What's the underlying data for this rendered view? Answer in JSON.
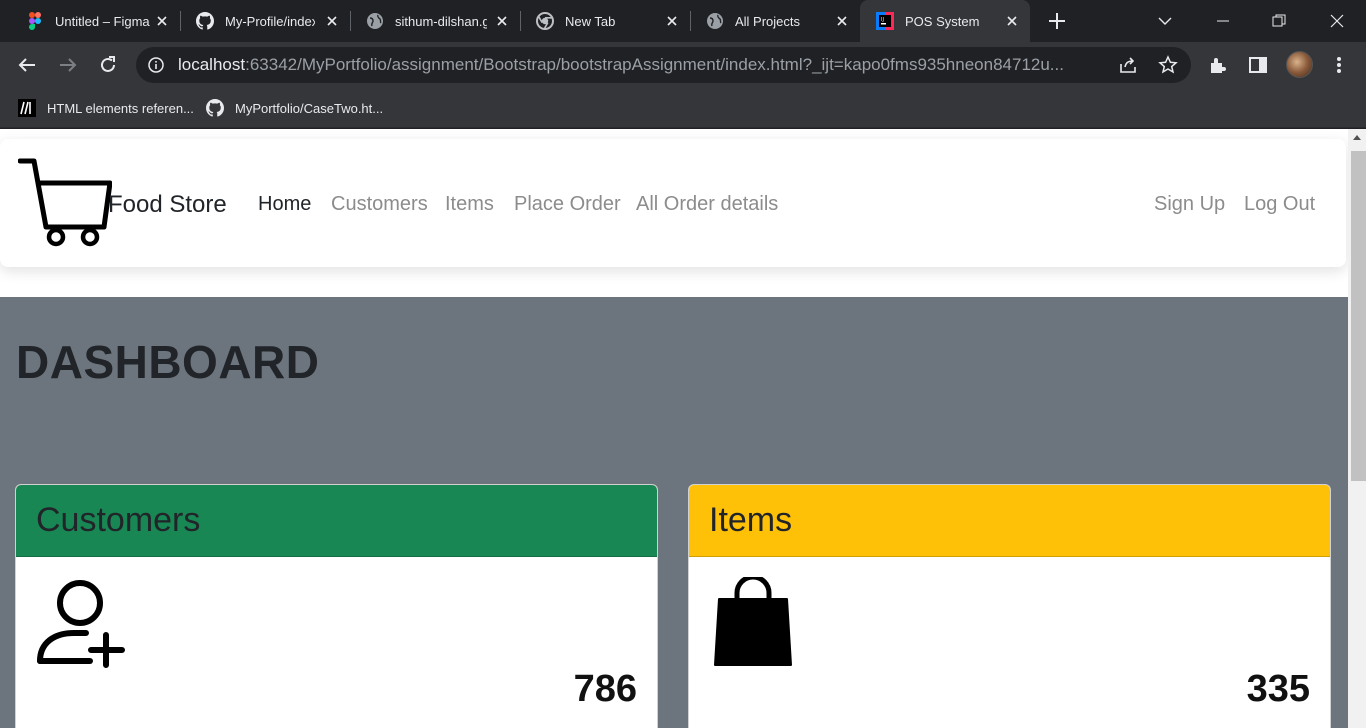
{
  "browser": {
    "tabs": [
      {
        "title": "Untitled – Figma",
        "icon": "figma-icon"
      },
      {
        "title": "My-Profile/index",
        "icon": "github-icon"
      },
      {
        "title": "sithum-dilshan.g",
        "icon": "globe-icon"
      },
      {
        "title": "New Tab",
        "icon": "chrome-icon"
      },
      {
        "title": "All Projects",
        "icon": "globe-icon"
      },
      {
        "title": "POS System",
        "icon": "jetbrains-icon",
        "active": true
      }
    ],
    "url_host": "localhost",
    "url_rest": ":63342/MyPortfolio/assignment/Bootstrap/bootstrapAssignment/index.html?_ijt=kapo0fms935hneon84712u...",
    "bookmarks": [
      {
        "label": "HTML elements referen...",
        "icon": "mdn-icon"
      },
      {
        "label": "MyPortfolio/CaseTwo.ht...",
        "icon": "github-icon"
      }
    ]
  },
  "navbar": {
    "brand": "Food Store",
    "links": [
      "Home",
      "Customers",
      "Items",
      "Place Order",
      "All Order details"
    ],
    "right_links": [
      "Sign Up",
      "Log Out"
    ]
  },
  "dashboard": {
    "title": "DASHBOARD",
    "cards": [
      {
        "title": "Customers",
        "count": "786",
        "header_color": "#198754",
        "icon": "add-user-icon"
      },
      {
        "title": "Items",
        "count": "335",
        "header_color": "#ffc107",
        "icon": "shopping-bag-icon"
      }
    ]
  },
  "colors": {
    "hero_bg": "#6c757d",
    "chrome_dark": "#202124",
    "chrome_toolbar": "#35363a"
  }
}
